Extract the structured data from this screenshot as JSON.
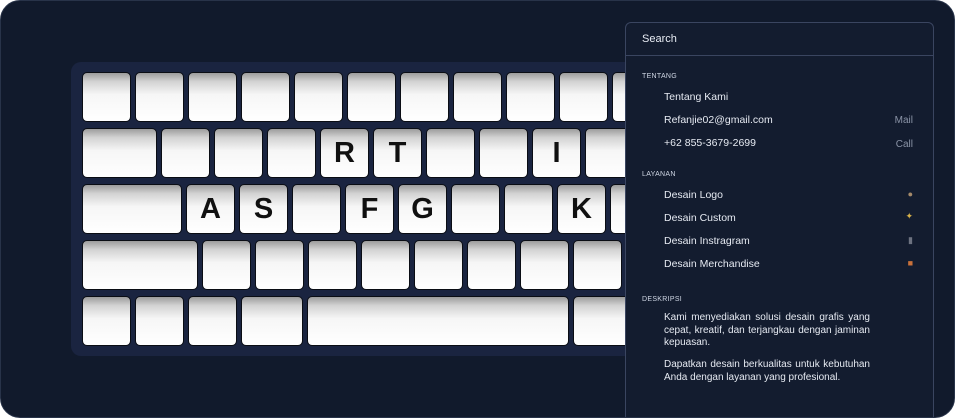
{
  "keyboard": {
    "keys": [
      "",
      "R",
      "T",
      "I",
      "A",
      "S",
      "F",
      "G",
      "K"
    ]
  },
  "panel": {
    "search_label": "Search",
    "tentang": {
      "title": "TENTANG",
      "items": [
        {
          "label": "Tentang Kami",
          "hint": ""
        },
        {
          "label": "Refanjie02@gmail.com",
          "hint": "Mail"
        },
        {
          "label": "+62 855-3679-2699",
          "hint": "Call"
        }
      ]
    },
    "layanan": {
      "title": "LAYANAN",
      "items": [
        {
          "label": "Desain Logo",
          "icon": "palette-icon",
          "color": "#a58a6a"
        },
        {
          "label": "Desain Custom",
          "icon": "sparkle-icon",
          "color": "#d8b24a"
        },
        {
          "label": "Desain Instragram",
          "icon": "phone-icon",
          "color": "#6d7280"
        },
        {
          "label": "Desain Merchandise",
          "icon": "gift-icon",
          "color": "#c9713a"
        }
      ]
    },
    "deskripsi": {
      "title": "DESKRIPSI",
      "paragraphs": [
        "Kami menyediakan solusi desain grafis yang cepat, kreatif, dan terjangkau dengan jaminan kepuasan.",
        "Dapatkan desain berkualitas untuk kebutuhan Anda dengan layanan yang profesional."
      ]
    }
  }
}
